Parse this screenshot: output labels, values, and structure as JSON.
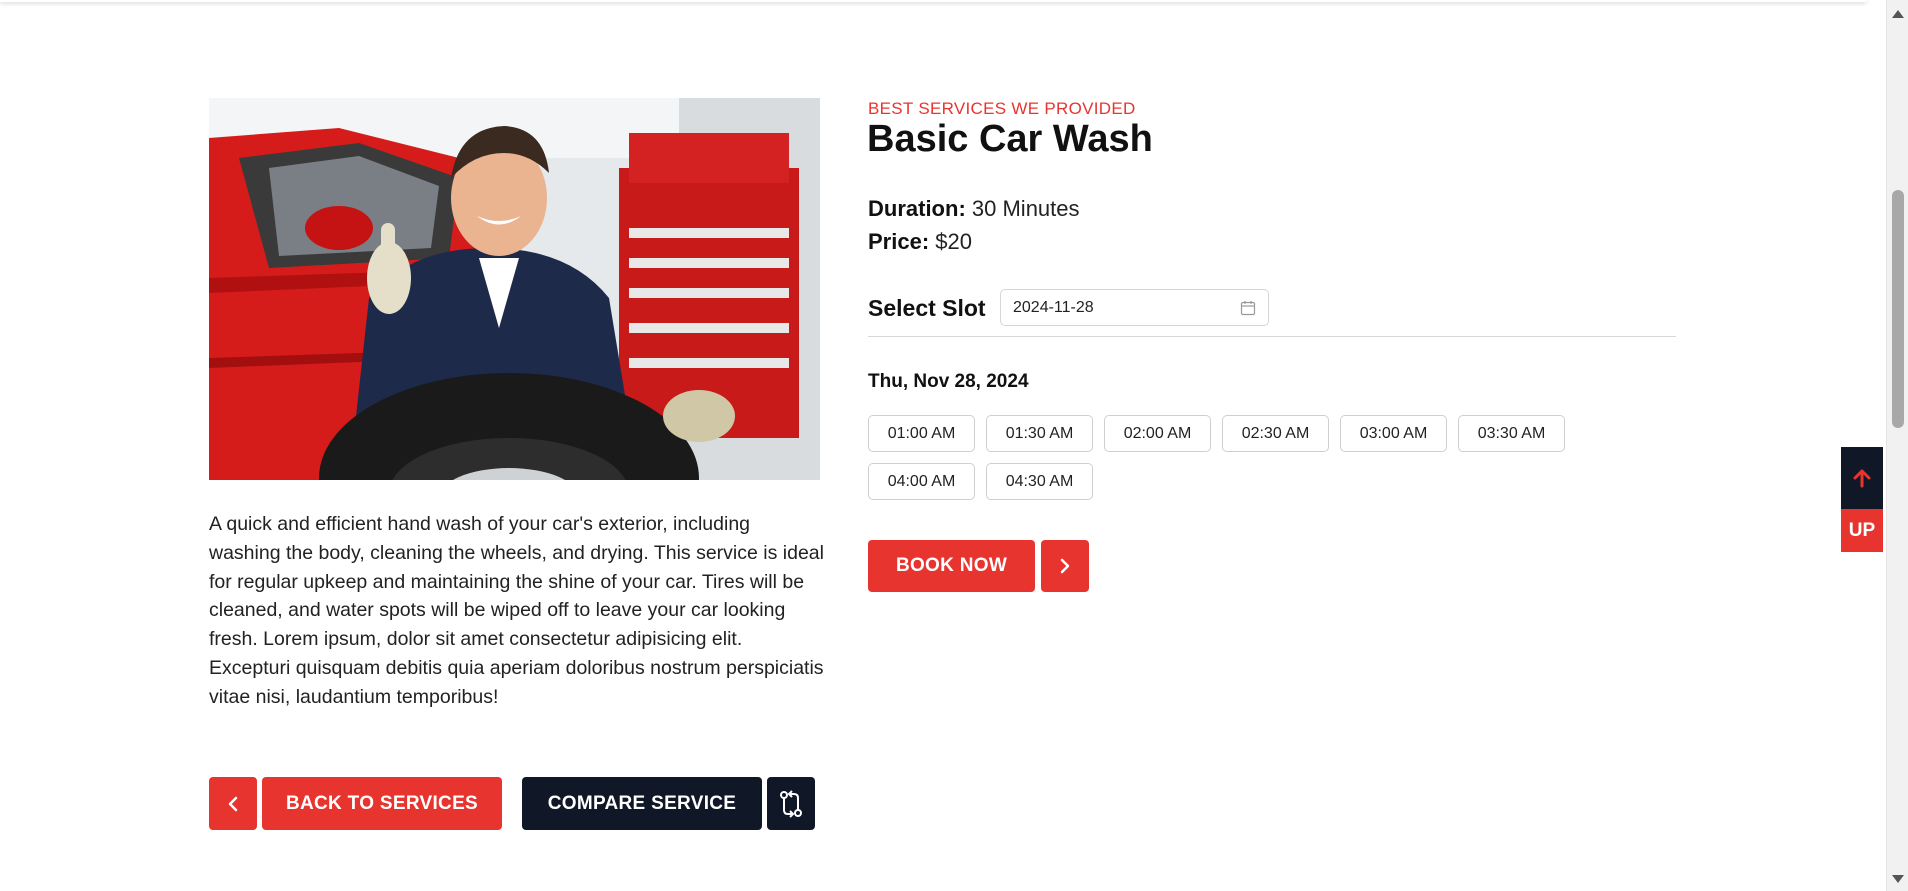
{
  "service": {
    "eyebrow": "BEST SERVICES WE PROVIDED",
    "title": "Basic Car Wash",
    "duration_label": "Duration:",
    "duration_value": "30 Minutes",
    "price_label": "Price:",
    "price_value": "$20",
    "description": "A quick and efficient hand wash of your car's exterior, including washing the body, cleaning the wheels, and drying. This service is ideal for regular upkeep and maintaining the shine of your car. Tires will be cleaned, and water spots will be wiped off to leave your car looking fresh. Lorem ipsum, dolor sit amet consectetur adipisicing elit. Excepturi quisquam debitis quia aperiam doloribus nostrum perspiciatis vitae nisi, laudantium temporibus!"
  },
  "booking": {
    "slot_label": "Select Slot",
    "date_value": "2024-11-28",
    "date_heading": "Thu, Nov 28, 2024",
    "slots": [
      "01:00 AM",
      "01:30 AM",
      "02:00 AM",
      "02:30 AM",
      "03:00 AM",
      "03:30 AM",
      "04:00 AM",
      "04:30 AM"
    ],
    "book_label": "BOOK NOW"
  },
  "actions": {
    "back_label": "BACK TO SERVICES",
    "compare_label": "COMPARE SERVICE"
  },
  "floating": {
    "up_label": "UP"
  },
  "colors": {
    "accent": "#e8342f",
    "dark": "#101828"
  },
  "icons": {
    "calendar": "calendar-icon",
    "chevron_left": "chevron-left-icon",
    "chevron_right": "chevron-right-icon",
    "compare": "compare-arrows-icon",
    "arrow_up": "arrow-up-icon"
  }
}
